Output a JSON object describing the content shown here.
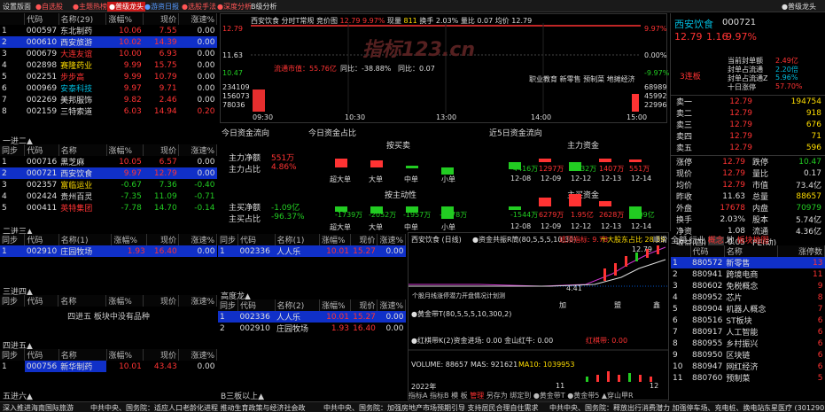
{
  "topbar": {
    "t0": "设置版面",
    "t1": "●自选股",
    "t2": "●主题热榜",
    "t3": "●普级龙头",
    "t4": "●游资日报",
    "t5": "●选股手法",
    "t6": "●深度分析",
    "t7": "B级分析",
    "right": "●普级龙头"
  },
  "lb1": {
    "headers": [
      "",
      "代码",
      "名称(29)",
      "涨幅%",
      "现价",
      "涨速%"
    ],
    "rows": [
      [
        "1",
        "000597",
        "东北制药",
        "10.06",
        "7.55",
        "0.00"
      ],
      [
        "2",
        "000610",
        "西安旅游",
        "10.02",
        "14.39",
        "0.00"
      ],
      [
        "3",
        "000679",
        "大连友谊",
        "10.00",
        "6.93",
        "0.00"
      ],
      [
        "4",
        "002898",
        "赛隆药业",
        "9.99",
        "15.75",
        "0.00"
      ],
      [
        "5",
        "002251",
        "步步高",
        "9.99",
        "10.79",
        "0.00"
      ],
      [
        "6",
        "000969",
        "安泰科技",
        "9.97",
        "9.71",
        "0.00"
      ],
      [
        "7",
        "002269",
        "美邦服饰",
        "9.82",
        "2.46",
        "0.00"
      ],
      [
        "8",
        "002159",
        "三特索道",
        "6.03",
        "14.94",
        "0.20"
      ]
    ]
  },
  "sec2": {
    "title": "一进二▲",
    "headers": [
      "同步",
      "代码",
      "名称",
      "涨幅%",
      "现价",
      "涨速%"
    ],
    "rows": [
      [
        "1",
        "000716",
        "黑芝麻",
        "10.05",
        "6.57",
        "0.00"
      ],
      [
        "2",
        "000721",
        "西安饮食",
        "9.97",
        "12.79",
        "0.00"
      ],
      [
        "3",
        "002357",
        "富临运业",
        "-0.67",
        "7.36",
        "-0.40"
      ],
      [
        "4",
        "002424",
        "贵州百灵",
        "-7.35",
        "11.09",
        "-0.71"
      ],
      [
        "5",
        "000411",
        "英特集团",
        "-7.78",
        "14.70",
        "-0.14"
      ]
    ]
  },
  "sec3": {
    "title": "二进三▲",
    "headers": [
      "同步",
      "代码",
      "名称(1)",
      "涨幅%",
      "现价",
      "涨速%"
    ],
    "rows": [
      [
        "1",
        "002910",
        "庄园牧场",
        "1.93",
        "16.40",
        "0.00"
      ]
    ]
  },
  "sec3b": {
    "headers": [
      "同步",
      "代码",
      "名称(1)",
      "涨幅%",
      "现价",
      "涨速%"
    ],
    "rows": [
      [
        "1",
        "002336",
        "人人乐",
        "10.01",
        "15.27",
        "0.00"
      ]
    ]
  },
  "sec4": {
    "title": "三进四▲",
    "headers": [
      "同步",
      "代码",
      "名称",
      "涨幅%",
      "现价",
      "涨速%"
    ],
    "note": "四进五 板块中没有品种"
  },
  "sec5": {
    "title": "四进五▲",
    "headers": [
      "同步",
      "代码",
      "名称",
      "涨幅%",
      "现价",
      "涨速%"
    ],
    "rows": [
      [
        "1",
        "000756",
        "新华制药",
        "10.01",
        "43.43",
        "0.00"
      ]
    ]
  },
  "sec6": {
    "title": "五进六▲"
  },
  "gaodu": {
    "title": "高度龙▲",
    "headers": [
      "同步",
      "代码",
      "名称(2)",
      "涨幅%",
      "现价",
      "涨速%"
    ],
    "rows": [
      [
        "1",
        "002336",
        "人人乐",
        "10.01",
        "15.27",
        "0.00"
      ],
      [
        "2",
        "002910",
        "庄园牧场",
        "1.93",
        "16.40",
        "0.00"
      ]
    ]
  },
  "b3": {
    "title": "B三板以上▲"
  },
  "chart": {
    "header": [
      "西安饮食",
      "分时T常规",
      "竞价图"
    ],
    "price": "12.79",
    "pct": "9.97%",
    "vol_l": "现量",
    "vol": "811",
    "hs": "换手 2.03%",
    "turn_l": "量比",
    "turn": "0.07",
    "jun": "均价 12.79",
    "yaxis_left": [
      "12.79",
      "11.63",
      "10.47",
      "9.69",
      "234109",
      "156073",
      "78036"
    ],
    "yaxis_right": [
      "9.97%",
      "0.00%",
      "-9.97%",
      "68989",
      "45992",
      "22996"
    ],
    "times": [
      "09:30",
      "10:30",
      "13:00",
      "14:00",
      "15:00"
    ],
    "liutong": "流通市值：55.76亿",
    "tongbi": "同比：-38.88%",
    "fenkao": "同比：0.07",
    "concept": "职业教育 新零售 预制菜 地摊经济",
    "watermark": "指标123.cn"
  },
  "capflow": {
    "t1": "今日资金流向",
    "t2": "今日资金占比",
    "t3": "近5日资金流向",
    "zhuliJing": "主力净额",
    "zhuliVal": "551万",
    "zhuliZb": "主力占比",
    "zhuliZbVal": "4.86%",
    "zhumai": "主买净额",
    "zhumaiVal": "-1.09亿",
    "zhumaiZb": "主买占比",
    "zhumaiZbVal": "-96.37%",
    "anjie": "按买卖",
    "anzhu": "按主动性",
    "cats": [
      "超大单",
      "大单",
      "中单",
      "小单"
    ],
    "v1": [
      "355万",
      "196万",
      "-11万",
      "-539万"
    ],
    "v2": [
      "-1739万",
      "-2052万",
      "-1957万",
      "-4078万"
    ],
    "zhuli": "主力资金",
    "zhumai2": "主买资金",
    "d1": [
      "-4416万",
      "1297万",
      "-2632万",
      "1407万",
      "551万"
    ],
    "d2": [
      "-1544万",
      "6279万",
      "1.95亿",
      "2628万",
      "-1.09亿"
    ],
    "dates": [
      "12-08",
      "12-09",
      "12-12",
      "12-13",
      "12-14"
    ]
  },
  "quote": {
    "name": "西安饮食",
    "code": "000721",
    "price": "12.79",
    "chg": "1.16",
    "pct": "9.97%",
    "ztd": "当前封单额",
    "ztdv": "2.49亿",
    "fb": "封单占流通",
    "fbv": "2.20倍",
    "fd": "封单占流通Z",
    "fdv": "5.96%",
    "shi": "十日涨停",
    "shiv": "57.70%",
    "lianban": "3连板",
    "ask": [
      [
        "卖一",
        "12.79",
        "194754"
      ],
      [
        "卖二",
        "12.79",
        "918"
      ],
      [
        "卖三",
        "12.79",
        "676"
      ],
      [
        "卖四",
        "12.79",
        "71"
      ],
      [
        "卖五",
        "12.79",
        "596"
      ]
    ],
    "stats": [
      [
        "涨停",
        "12.79",
        "跌停",
        "10.47"
      ],
      [
        "现价",
        "12.79",
        "量比",
        "0.17"
      ],
      [
        "均价",
        "12.79",
        "市值",
        "73.4亿"
      ],
      [
        "昨收",
        "11.63",
        "总量",
        "88657"
      ],
      [
        "外盘",
        "17678",
        "内盘",
        "70979"
      ],
      [
        "换手",
        "2.03%",
        "股本",
        "5.74亿"
      ],
      [
        "净资",
        "1.08",
        "流通",
        "4.36亿"
      ],
      [
        "收益(四)",
        "-0.05",
        "PE(动)",
        ""
      ]
    ]
  },
  "kline": {
    "title": "西安饮食 (日线)",
    "ind": "●资金共振R筒(80,5,5,5,10,30)",
    "lbl": "逃顶指标: 9.78",
    "lbl2": "十大股东占比 28.39",
    "lbl3": "顺滑",
    "p1": "12.79",
    "p2": "4.41",
    "note": "个股月线涨停潜力开盘情况计划测",
    "vol": "VOLUME: 88657",
    "mas": "MAS: 921621",
    "ma10": "MA10: 1039953",
    "sub1": "●黄金带T(80,5,5,5,10,300,2)",
    "sub2": "●红棋带K(2)资金进场: 0.00 金山红牛: 0.00",
    "sub2b": "红棋带: 0.00",
    "year": "2022年",
    "m11": "11",
    "m12": "12",
    "bottomtabs": [
      "指标A",
      "指标B",
      "模",
      "板",
      "管理",
      "另存为",
      "绑定到",
      "●黄金带T",
      "●黄金带5",
      "▲穿山甲R"
    ],
    "bottomtab_label": "●资金共振R",
    "tags": [
      "加",
      "盟",
      "鑫"
    ]
  },
  "board": {
    "tabs": [
      "全部",
      "行业",
      "概念",
      "地",
      "板块地图"
    ],
    "headers": [
      "",
      "代码",
      "名称",
      "涨停数"
    ],
    "rows": [
      [
        "1",
        "880572",
        "新零售",
        "13"
      ],
      [
        "2",
        "880941",
        "跨境电商",
        "11"
      ],
      [
        "3",
        "880602",
        "免税概念",
        "9"
      ],
      [
        "4",
        "880952",
        "芯片",
        "8"
      ],
      [
        "5",
        "880904",
        "机器人概念",
        "7"
      ],
      [
        "6",
        "880516",
        "ST板块",
        "6"
      ],
      [
        "7",
        "880917",
        "人工智能",
        "6"
      ],
      [
        "8",
        "880955",
        "乡村振兴",
        "6"
      ],
      [
        "9",
        "880950",
        "区块链",
        "6"
      ],
      [
        "10",
        "880947",
        "网红经济",
        "6"
      ],
      [
        "11",
        "880760",
        "预制菜",
        "5"
      ]
    ]
  },
  "ticker": {
    "t1": "深入推进海南国际旅游",
    "t2": "中共中央、国务院：适应人口老龄化进程 推动生育政策与经济社会政",
    "t3": "中共中央、国务院：加强房地产市场预期引导 支持居民合理自住需求",
    "t4": "中共中央、国务院：释放出行消费潜力 加强停车场、充电桩、换电站",
    "t5": "东星医疗 (301290)"
  }
}
